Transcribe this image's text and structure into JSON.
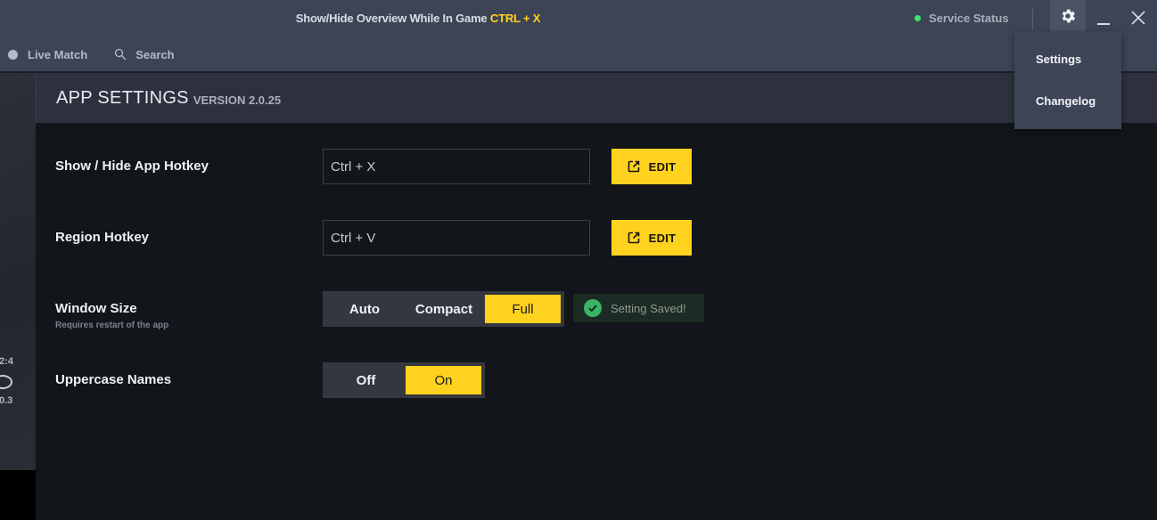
{
  "titlebar": {
    "title_text": "Show/Hide Overview While In Game",
    "title_hotkey": "CTRL + X",
    "service_status_label": "Service Status",
    "service_status_color": "#3ee56a"
  },
  "nav": {
    "items": [
      {
        "label": "Live Match",
        "icon": "circle-icon"
      },
      {
        "label": "Search",
        "icon": "search-icon"
      }
    ]
  },
  "left_strip": {
    "text_top": "2:4",
    "text_bottom": "0.3"
  },
  "settings_menu": {
    "items": [
      {
        "label": "Settings"
      },
      {
        "label": "Changelog"
      }
    ]
  },
  "panel": {
    "title": "APP SETTINGS",
    "version": "VERSION 2.0.25",
    "settings": [
      {
        "label": "Show / Hide App Hotkey",
        "value": "Ctrl + X",
        "button": "EDIT"
      },
      {
        "label": "Region Hotkey",
        "value": "Ctrl + V",
        "button": "EDIT"
      },
      {
        "label": "Window Size",
        "sublabel": "Requires restart of the app",
        "options": [
          "Auto",
          "Compact",
          "Full"
        ],
        "selected": "Full"
      },
      {
        "label": "Uppercase Names",
        "options": [
          "Off",
          "On"
        ],
        "selected": "On"
      }
    ],
    "toast": "Setting Saved!"
  },
  "colors": {
    "accent": "#ffd21f",
    "success": "#3bb466",
    "topbar": "#3d4455",
    "panel_bg": "#12151a"
  }
}
